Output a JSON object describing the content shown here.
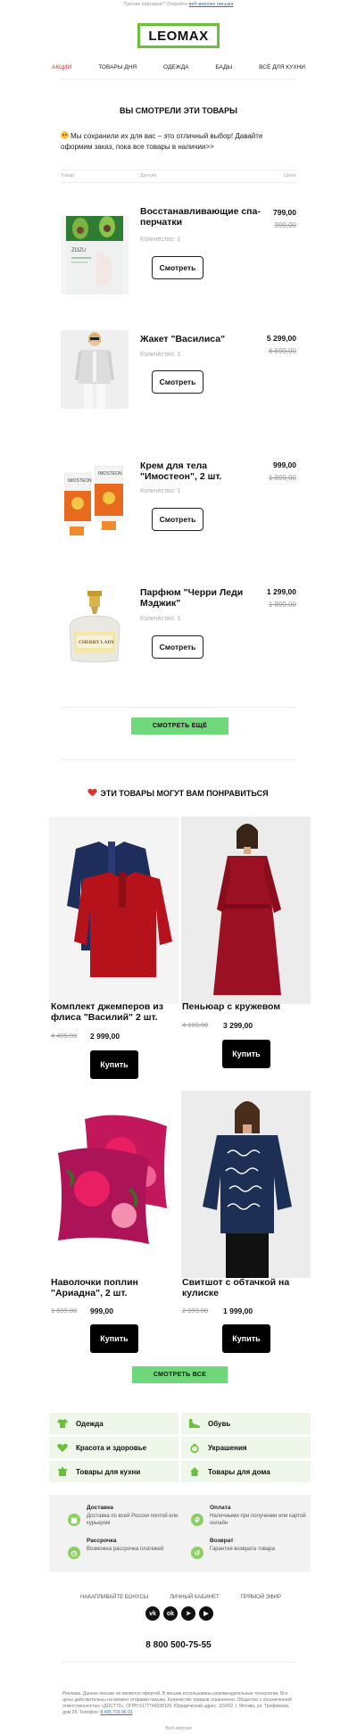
{
  "preheader": {
    "text": "Прочие картинки? Откройте",
    "link": "веб-версию письма"
  },
  "logo": "LEOMAX",
  "nav": [
    "АКЦИИ",
    "ТОВАРЫ ДНЯ",
    "ОДЕЖДА",
    "БАДЫ",
    "ВСЁ ДЛЯ КУХНИ"
  ],
  "viewed": {
    "title": "ВЫ СМОТРЕЛИ ЭТИ ТОВАРЫ",
    "intro": "Мы сохранили их для вас – это отличный выбор! Давайте оформим заказ, пока все товары в наличии>>",
    "col_product": "Товар",
    "col_details": "Детали",
    "col_price": "Цена",
    "items": [
      {
        "name": "Восстанавливающие спа-перчатки",
        "qty": "Количество: 1",
        "price": "799,00",
        "old": "999,00",
        "button": "Смотреть"
      },
      {
        "name": "Жакет \"Василиса\"",
        "qty": "Количество: 1",
        "price": "5 299,00",
        "old": "6 699,00",
        "button": "Смотреть"
      },
      {
        "name": "Крем для тела \"Имостеон\", 2 шт.",
        "qty": "Количество: 1",
        "price": "999,00",
        "old": "1 399,00",
        "button": "Смотреть"
      },
      {
        "name": "Парфюм \"Черри Леди Мэджик\"",
        "qty": "Количество: 1",
        "price": "1 299,00",
        "old": "1 899,00",
        "button": "Смотреть"
      }
    ],
    "more_button": "СМОТРЕТЬ ЕЩЁ"
  },
  "recommend": {
    "title": "ЭТИ ТОВАРЫ МОГУТ ВАМ ПОНРАВИТЬСЯ",
    "items": [
      {
        "name": "Комплект джемперов из флиса \"Василий\" 2 шт.",
        "old": "4 499,00",
        "price": "2 999,00",
        "button": "Купить"
      },
      {
        "name": "Пеньюар с кружевом",
        "old": "4 199,00",
        "price": "3 299,00",
        "button": "Купить"
      },
      {
        "name": "Наволочки поплин \"Ариадна\", 2 шт.",
        "old": "1 699,00",
        "price": "999,00",
        "button": "Купить"
      },
      {
        "name": "Свитшот с обтачкой на кулиске",
        "old": "2 999,00",
        "price": "1 999,00",
        "button": "Купить"
      }
    ],
    "all_button": "СМОТРЕТЬ ВСЕ"
  },
  "categories": [
    {
      "label": "Одежда",
      "icon": "tshirt-icon"
    },
    {
      "label": "Обувь",
      "icon": "shoe-icon"
    },
    {
      "label": "Красота и здоровье",
      "icon": "heart-icon"
    },
    {
      "label": "Украшения",
      "icon": "ring-icon"
    },
    {
      "label": "Товары для кухни",
      "icon": "pot-icon"
    },
    {
      "label": "Товары для дома",
      "icon": "house-icon"
    }
  ],
  "info": [
    {
      "title": "Доставка",
      "text": "Доставка по всей России почтой или курьером",
      "icon": "box-icon"
    },
    {
      "title": "Оплата",
      "text": "Наличными при получении или картой онлайн",
      "icon": "ruble-icon"
    },
    {
      "title": "Рассрочка",
      "text": "Возможна рассрочка платежей",
      "icon": "clock-icon"
    },
    {
      "title": "Возврат",
      "text": "Гарантия возврата товара",
      "icon": "return-icon"
    }
  ],
  "footer_links": [
    "НАКАПЛИВАЙТЕ БОНУСЫ",
    "ЛИЧНЫЙ КАБИНЕТ",
    "ПРЯМОЙ ЭФИР"
  ],
  "social": [
    "vk-icon",
    "ok-icon",
    "telegram-icon",
    "youtube-icon"
  ],
  "phone": "8 800 500-75-55",
  "legal": "Реклама. Данное письмо не является офертой. В письме использованы рекомендательные технологии. Все цены действительны на момент отправки письма. Количество товаров ограничено. Общество с ограниченной ответственностью «ДОСТ70», ОГРН 5177746038126. Юридический адрес: 115432, г. Москва, ул. Трофимова, дом 24. Телефон:",
  "legal_phone": "8 495 733 96 03",
  "web_version": "Веб-версия",
  "colors": {
    "accent": "#6fd87a",
    "logo_border": "#6cbf3b",
    "nav_active": "#e0332b",
    "category_bg": "#eef7ea"
  }
}
